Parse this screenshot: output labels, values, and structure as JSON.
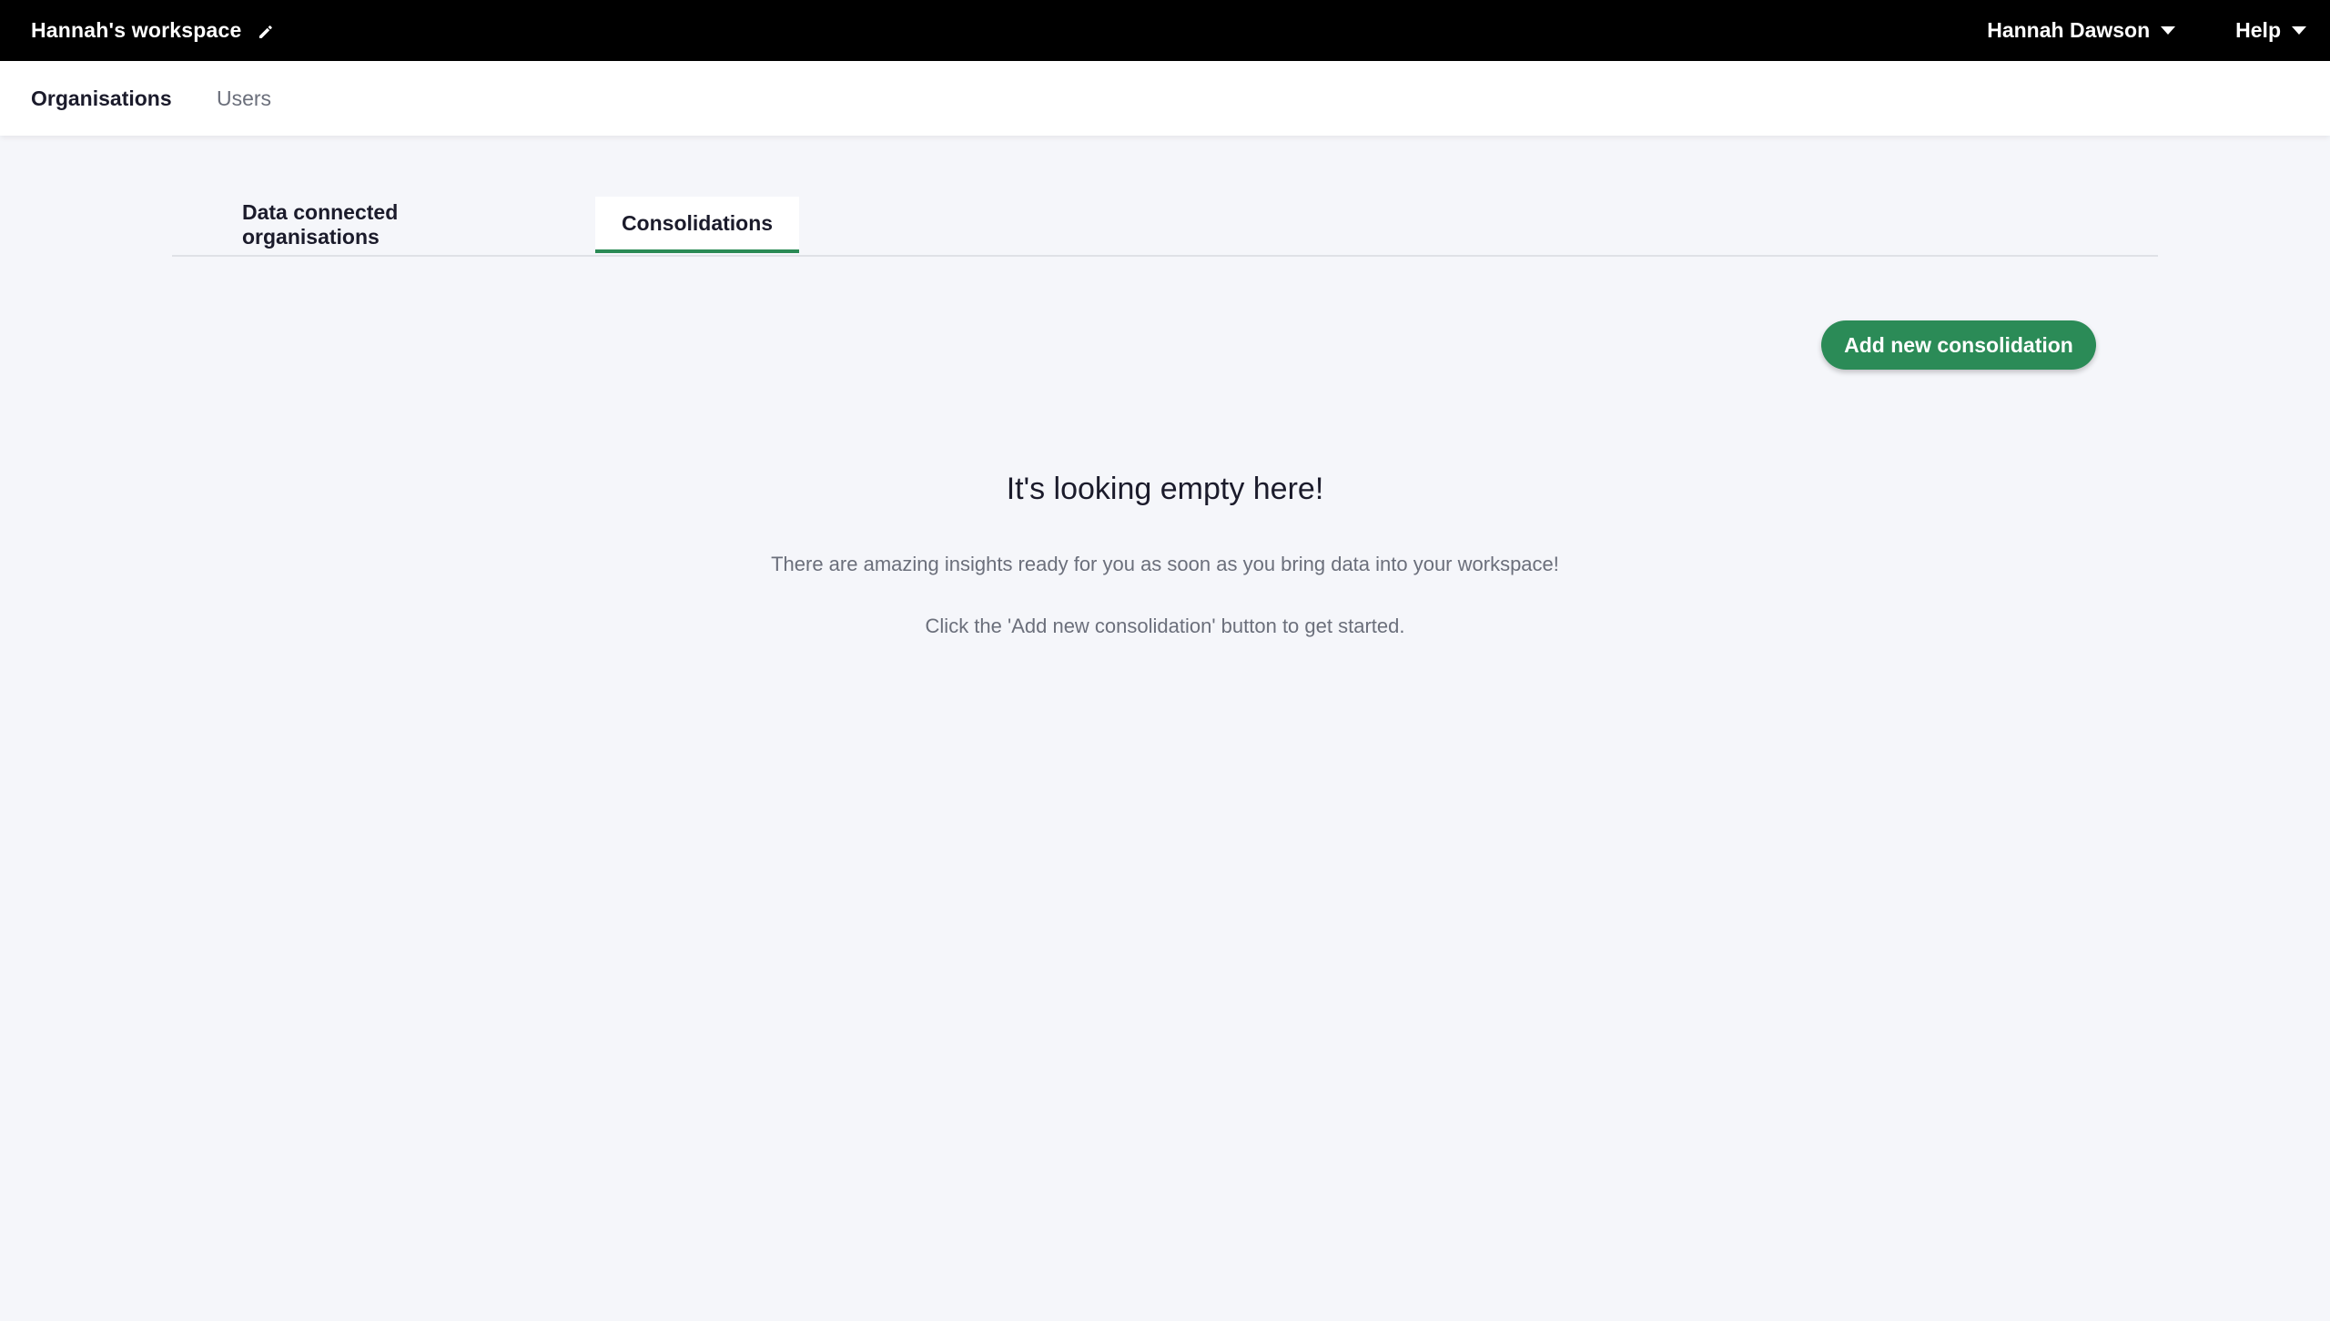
{
  "topbar": {
    "workspace_title": "Hannah's workspace",
    "user_menu_label": "Hannah Dawson",
    "help_menu_label": "Help"
  },
  "subnav": {
    "items": [
      {
        "label": "Organisations",
        "active": true
      },
      {
        "label": "Users",
        "active": false
      }
    ]
  },
  "tabs": [
    {
      "label": "Data connected organisations",
      "active": false
    },
    {
      "label": "Consolidations",
      "active": true
    }
  ],
  "actions": {
    "add_button_label": "Add new consolidation"
  },
  "empty_state": {
    "title": "It's looking empty here!",
    "line1": "There are amazing insights ready for you as soon as you bring data into your workspace!",
    "line2": "Click the 'Add new consolidation' button to get started."
  },
  "colors": {
    "accent": "#2b8b57",
    "topbar_bg": "#000000",
    "page_bg": "#f5f6fa"
  },
  "icons": [
    "pencil-icon",
    "chevron-down-icon"
  ]
}
